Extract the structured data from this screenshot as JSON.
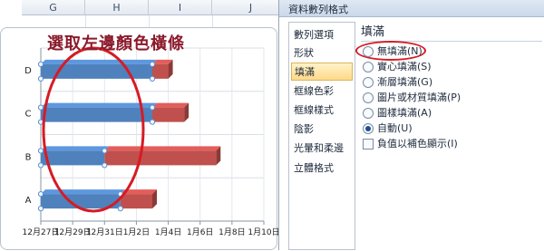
{
  "sheet": {
    "columns": [
      "G",
      "H",
      "I",
      "J"
    ]
  },
  "chart_note": "選取左邊顏色橫條",
  "chart_data": {
    "type": "bar",
    "orientation": "horizontal",
    "stacked": true,
    "categories": [
      "A",
      "B",
      "C",
      "D"
    ],
    "x_axis_type": "date",
    "xlim": [
      "2009-12-27",
      "2010-01-10"
    ],
    "tick_labels": [
      "12月27日",
      "12月29日",
      "12月31日",
      "1月2日",
      "1月4日",
      "1月6日",
      "1月8日",
      "1月10日"
    ],
    "series": [
      {
        "color": "#4f81bd",
        "start": [
          "2009-12-27",
          "2009-12-27",
          "2009-12-27",
          "2009-12-27"
        ],
        "end": [
          "2010-01-01",
          "2009-12-31",
          "2010-01-03",
          "2010-01-03"
        ]
      },
      {
        "color": "#c0504d",
        "start": [
          "2010-01-01",
          "2009-12-31",
          "2010-01-03",
          "2010-01-03"
        ],
        "end": [
          "2010-01-03",
          "2010-01-07",
          "2010-01-05",
          "2010-01-04"
        ]
      }
    ],
    "grid": true
  },
  "dialog": {
    "title": "資料數列格式",
    "nav_items": [
      "數列選項",
      "形狀",
      "填滿",
      "框線色彩",
      "框線樣式",
      "陰影",
      "光暈和柔邊",
      "立體格式"
    ],
    "selected_nav": "填滿",
    "section_title": "填滿",
    "fill_options": [
      "無填滿(N)",
      "實心填滿(S)",
      "漸層填滿(G)",
      "圖片或材質填滿(P)",
      "圖樣填滿(A)",
      "自動(U)"
    ],
    "selected_option": "自動(U)",
    "invert_label": "負值以補色顯示(I)"
  },
  "colors": {
    "bar_blue": "#4f81bd",
    "bar_red": "#c0504d",
    "annotation_red": "#d61b24",
    "annotation_text": "#8b1a2b"
  }
}
